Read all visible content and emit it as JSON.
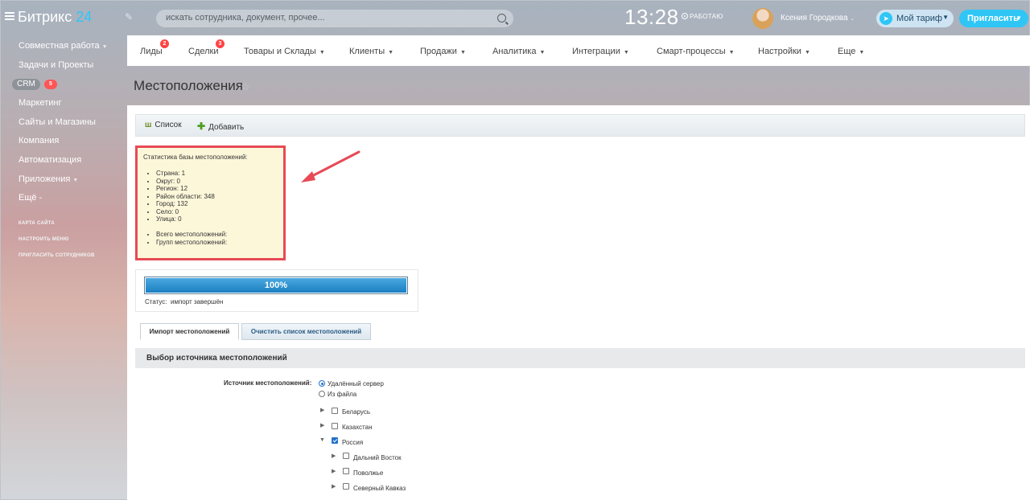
{
  "header": {
    "logo_text": "Битрикс",
    "logo_number": "24",
    "search_placeholder": "искать сотрудника, документ, прочее...",
    "clock": "13:28",
    "work_status": "РАБОТАЮ",
    "user_name": "Ксения Городкова",
    "plan_label": "Мой тариф",
    "invite_label": "Пригласить"
  },
  "sidebar": {
    "items": [
      {
        "label": "Совместная работа",
        "has_chevron": true
      },
      {
        "label": "Задачи и Проекты",
        "has_chevron": false
      },
      {
        "label": "CRM",
        "badge": "5"
      },
      {
        "label": "Маркетинг",
        "has_chevron": false
      },
      {
        "label": "Сайты и Магазины",
        "has_chevron": false
      },
      {
        "label": "Компания",
        "has_chevron": false
      },
      {
        "label": "Автоматизация",
        "has_chevron": false
      },
      {
        "label": "Приложения",
        "has_chevron": true
      },
      {
        "label": "Ещё -",
        "has_chevron": false
      }
    ],
    "links": [
      "КАРТА САЙТА",
      "НАСТРОИТЬ МЕНЮ",
      "ПРИГЛАСИТЬ СОТРУДНИКОВ"
    ]
  },
  "topnav": {
    "items": [
      {
        "label": "Лиды",
        "badge": "2"
      },
      {
        "label": "Сделки",
        "badge": "3"
      },
      {
        "label": "Товары и Склады",
        "chevron": true
      },
      {
        "label": "Клиенты",
        "chevron": true
      },
      {
        "label": "Продажи",
        "chevron": true
      },
      {
        "label": "Аналитика",
        "chevron": true
      },
      {
        "label": "Интеграции",
        "chevron": true
      },
      {
        "label": "Смарт-процессы",
        "chevron": true
      },
      {
        "label": "Настройки",
        "chevron": true
      },
      {
        "label": "Еще",
        "chevron": true
      }
    ]
  },
  "page": {
    "title": "Местоположения"
  },
  "toolbar": {
    "list_label": "Список",
    "add_label": "Добавить"
  },
  "stats": {
    "title": "Статистика базы местоположений:",
    "items": [
      "Страна: 1",
      "Округ: 0",
      "Регион: 12",
      "Район области: 348",
      "Город: 132",
      "Село: 0",
      "Улица: 0"
    ],
    "totals": [
      "Всего местоположений:",
      "Групп местоположений:"
    ]
  },
  "progress": {
    "percent": 100,
    "text": "100%",
    "status_label": "Статус:",
    "status_value": "импорт завершён"
  },
  "tabs": {
    "import_label": "Импорт местоположений",
    "clear_label": "Очистить список местоположений"
  },
  "section": {
    "title": "Выбор источника местоположений"
  },
  "source": {
    "label": "Источник местоположений:",
    "options": [
      {
        "label": "Удалённый сервер",
        "checked": true
      },
      {
        "label": "Из файла",
        "checked": false
      }
    ]
  },
  "tree": [
    {
      "label": "Беларусь",
      "checked": false,
      "expanded": false,
      "level": 0
    },
    {
      "label": "Казахстан",
      "checked": false,
      "expanded": false,
      "level": 0
    },
    {
      "label": "Россия",
      "checked": true,
      "expanded": true,
      "level": 0
    },
    {
      "label": "Дальний Восток",
      "checked": false,
      "expanded": false,
      "level": 1
    },
    {
      "label": "Поволжье",
      "checked": false,
      "expanded": false,
      "level": 1
    },
    {
      "label": "Северный Кавказ",
      "checked": false,
      "expanded": false,
      "level": 1
    }
  ],
  "colors": {
    "accent": "#2fc6f6",
    "highlight_border": "#e74a55",
    "badge": "#ff4444",
    "progress": "#1b7fc1"
  }
}
